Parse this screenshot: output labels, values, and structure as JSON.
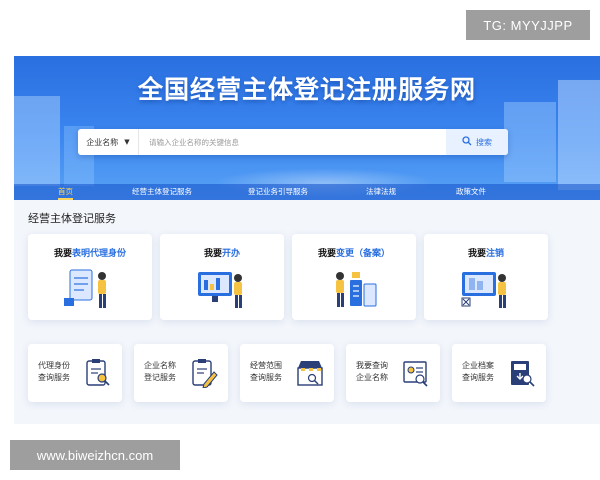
{
  "watermark_top": "TG: MYYJJPP",
  "watermark_bottom": "www.biweizhcn.com",
  "hero": {
    "title": "全国经营主体登记注册服务网"
  },
  "search": {
    "category": "企业名称",
    "placeholder": "请输入企业名称的关键信息",
    "button": "搜索"
  },
  "nav": {
    "items": [
      "首页",
      "经营主体登记服务",
      "登记业务引导服务",
      "法律法规",
      "政策文件"
    ],
    "active": "首页"
  },
  "section": {
    "title": "经营主体登记服务"
  },
  "big_cards": [
    {
      "prefix": "我要",
      "highlight": "表明代理身份",
      "suffix": ""
    },
    {
      "prefix": "我要",
      "highlight": "开办",
      "suffix": ""
    },
    {
      "prefix": "我要",
      "highlight": "变更（备案）",
      "suffix": ""
    },
    {
      "prefix": "我要",
      "highlight": "注销",
      "suffix": ""
    }
  ],
  "small_cards": [
    {
      "line1": "代理身份",
      "line2": "查询服务",
      "icon": "clipboard-search-icon"
    },
    {
      "line1": "企业名称",
      "line2": "登记服务",
      "icon": "clipboard-pen-icon"
    },
    {
      "line1": "经营范围",
      "line2": "查询服务",
      "icon": "storefront-icon"
    },
    {
      "line1": "我要查询",
      "line2": "企业名称",
      "icon": "certificate-search-icon"
    },
    {
      "line1": "企业档案",
      "line2": "查询服务",
      "icon": "archive-search-icon"
    }
  ],
  "colors": {
    "primary": "#2a6fe0",
    "accent": "#ffd65c",
    "figure": "#f5c242"
  }
}
